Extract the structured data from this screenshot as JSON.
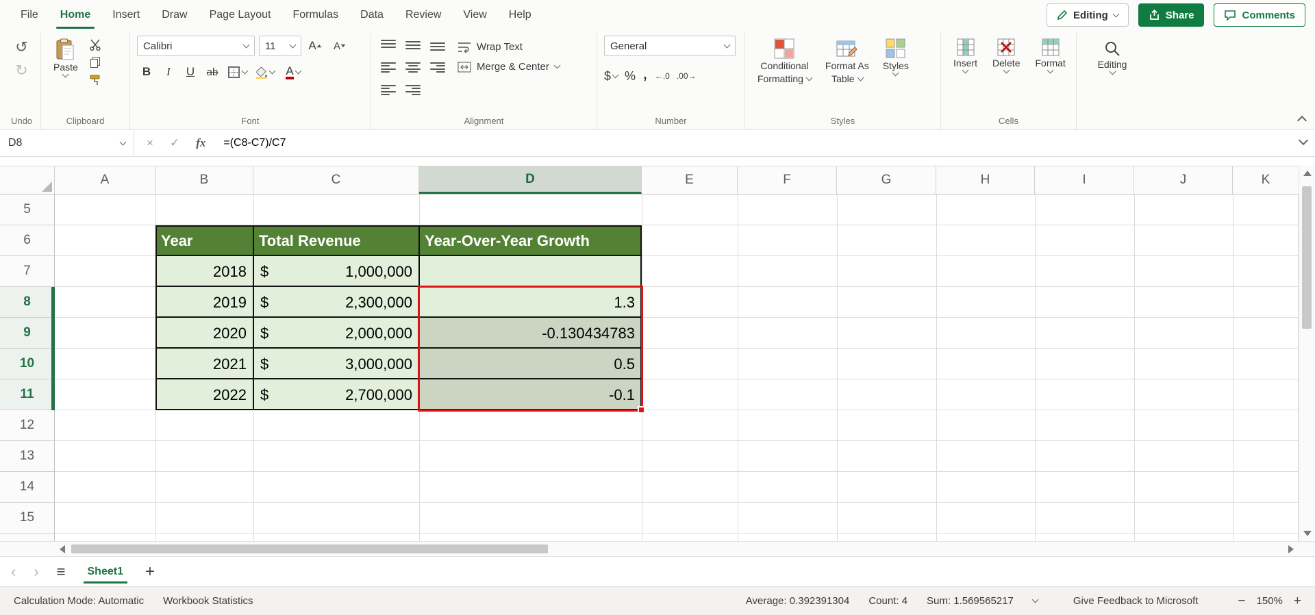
{
  "colors": {
    "excel_green": "#217346",
    "share_green": "#107c41",
    "table_header_fill": "#548235",
    "table_cell_fill": "#e2efda",
    "selection_overlay": "#cbd5c2",
    "selection_border_red": "#e01414"
  },
  "tabs": [
    "File",
    "Home",
    "Insert",
    "Draw",
    "Page Layout",
    "Formulas",
    "Data",
    "Review",
    "View",
    "Help"
  ],
  "top_right": {
    "editing": "Editing",
    "share": "Share",
    "comments": "Comments"
  },
  "ribbon": {
    "undo_icon": "↺",
    "redo_icon": "↻",
    "undo_label": "Undo",
    "clipboard": {
      "paste": "Paste",
      "label": "Clipboard"
    },
    "font": {
      "family": "Calibri",
      "size": "11",
      "grow": "A",
      "shrink": "A",
      "bold": "B",
      "italic": "I",
      "underline": "U",
      "strikethrough": "ab",
      "color_letter": "A",
      "label": "Font"
    },
    "alignment": {
      "wrap_text": "Wrap Text",
      "merge_center": "Merge & Center",
      "label": "Alignment"
    },
    "number": {
      "format": "General",
      "currency": "$",
      "percent": "%",
      "comma": ",",
      "inc": "←.0",
      "dec": ".00→",
      "label": "Number"
    },
    "styles": {
      "cond1": "Conditional",
      "cond2": "Formatting",
      "fat1": "Format As",
      "fat2": "Table",
      "styles": "Styles",
      "label": "Styles"
    },
    "cells": {
      "insert": "Insert",
      "delete": "Delete",
      "format": "Format",
      "label": "Cells"
    },
    "editing": {
      "button": "Editing"
    }
  },
  "formula_bar": {
    "name_box": "D8",
    "cancel": "×",
    "enter": "✓",
    "fx": "fx",
    "formula": "=(C8-C7)/C7"
  },
  "grid": {
    "columns": [
      "A",
      "B",
      "C",
      "D",
      "E",
      "F",
      "G",
      "H",
      "I",
      "J",
      "K"
    ],
    "rows": [
      "5",
      "6",
      "7",
      "8",
      "9",
      "10",
      "11",
      "12",
      "13",
      "14",
      "15"
    ],
    "active_cell": "D8",
    "selected_range": "D8:D11"
  },
  "table": {
    "headers": {
      "year": "Year",
      "revenue": "Total Revenue",
      "growth": "Year-Over-Year Growth"
    },
    "rows": [
      {
        "year": "2018",
        "cur": "$",
        "revenue": "1,000,000",
        "growth": ""
      },
      {
        "year": "2019",
        "cur": "$",
        "revenue": "2,300,000",
        "growth": "1.3"
      },
      {
        "year": "2020",
        "cur": "$",
        "revenue": "2,000,000",
        "growth": "-0.130434783"
      },
      {
        "year": "2021",
        "cur": "$",
        "revenue": "3,000,000",
        "growth": "0.5"
      },
      {
        "year": "2022",
        "cur": "$",
        "revenue": "2,700,000",
        "growth": "-0.1"
      }
    ]
  },
  "sheet_bar": {
    "prev": "‹",
    "next": "›",
    "menu": "≡",
    "sheet_name": "Sheet1",
    "add": "+"
  },
  "status_bar": {
    "calc_mode": "Calculation Mode: Automatic",
    "workbook_stats": "Workbook Statistics",
    "average": "Average: 0.392391304",
    "count": "Count: 4",
    "sum": "Sum: 1.569565217",
    "feedback": "Give Feedback to Microsoft",
    "zoom_out": "−",
    "zoom": "150%",
    "zoom_in": "+"
  }
}
